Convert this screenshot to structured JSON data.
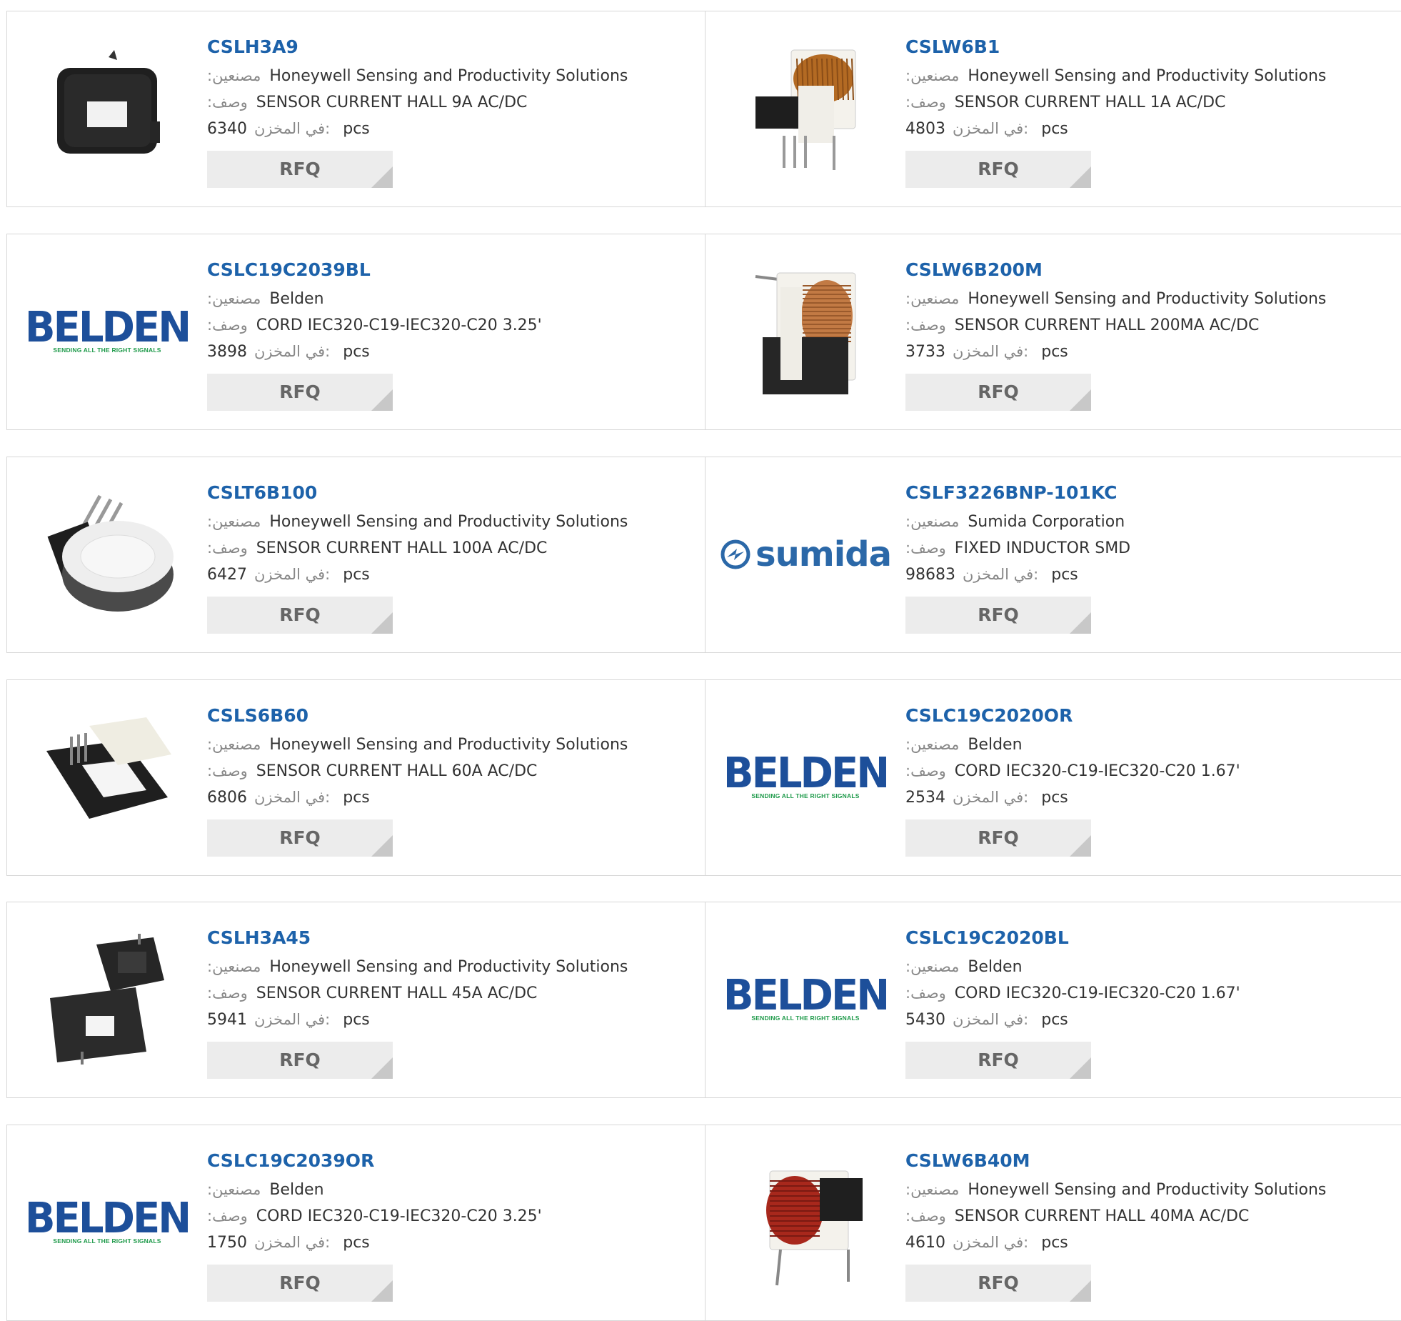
{
  "labels": {
    "manufacturer": ":مصنعين",
    "description": ":وصف",
    "in_stock": "في المخزن:",
    "unit": "pcs",
    "rfq": "RFQ"
  },
  "logo_text": {
    "belden": "BELDEN",
    "belden_tagline": "SENDING ALL THE RIGHT SIGNALS",
    "sumida": "sumida"
  },
  "colors": {
    "part_link": "#1d62aa",
    "rfq_bg": "#ececec",
    "belden_green": "#1e9a4a"
  },
  "products": [
    {
      "part": "CSLH3A9",
      "manufacturer": "Honeywell Sensing and Productivity Solutions",
      "description": "SENSOR CURRENT HALL 9A AC/DC",
      "stock": "6340",
      "image": "hall-sensor-ring"
    },
    {
      "part": "CSLW6B1",
      "manufacturer": "Honeywell Sensing and Productivity Solutions",
      "description": "SENSOR CURRENT HALL 1A AC/DC",
      "stock": "4803",
      "image": "coil-sensor-copper"
    },
    {
      "part": "CSLC19C2039BL",
      "manufacturer": "Belden",
      "description": "CORD IEC320-C19-IEC320-C20 3.25'",
      "stock": "3898",
      "image": "belden-logo"
    },
    {
      "part": "CSLW6B200M",
      "manufacturer": "Honeywell Sensing and Productivity Solutions",
      "description": "SENSOR CURRENT HALL 200MA AC/DC",
      "stock": "3733",
      "image": "coil-sensor-copper-tall"
    },
    {
      "part": "CSLT6B100",
      "manufacturer": "Honeywell Sensing and Productivity Solutions",
      "description": "SENSOR CURRENT HALL 100A AC/DC",
      "stock": "6427",
      "image": "toroid-sensor"
    },
    {
      "part": "CSLF3226BNP-101KC",
      "manufacturer": "Sumida Corporation",
      "description": "FIXED INDUCTOR SMD",
      "stock": "98683",
      "image": "sumida-logo"
    },
    {
      "part": "CSLS6B60",
      "manufacturer": "Honeywell Sensing and Productivity Solutions",
      "description": "SENSOR CURRENT HALL 60A AC/DC",
      "stock": "6806",
      "image": "split-core-sensor"
    },
    {
      "part": "CSLC19C2020OR",
      "manufacturer": "Belden",
      "description": "CORD IEC320-C19-IEC320-C20 1.67'",
      "stock": "2534",
      "image": "belden-logo"
    },
    {
      "part": "CSLH3A45",
      "manufacturer": "Honeywell Sensing and Productivity Solutions",
      "description": "SENSOR CURRENT HALL 45A AC/DC",
      "stock": "5941",
      "image": "hall-sensor-pair"
    },
    {
      "part": "CSLC19C2020BL",
      "manufacturer": "Belden",
      "description": "CORD IEC320-C19-IEC320-C20 1.67'",
      "stock": "5430",
      "image": "belden-logo"
    },
    {
      "part": "CSLC19C2039OR",
      "manufacturer": "Belden",
      "description": "CORD IEC320-C19-IEC320-C20 3.25'",
      "stock": "1750",
      "image": "belden-logo"
    },
    {
      "part": "CSLW6B40M",
      "manufacturer": "Honeywell Sensing and Productivity Solutions",
      "description": "SENSOR CURRENT HALL 40MA AC/DC",
      "stock": "4610",
      "image": "coil-sensor-red"
    }
  ]
}
